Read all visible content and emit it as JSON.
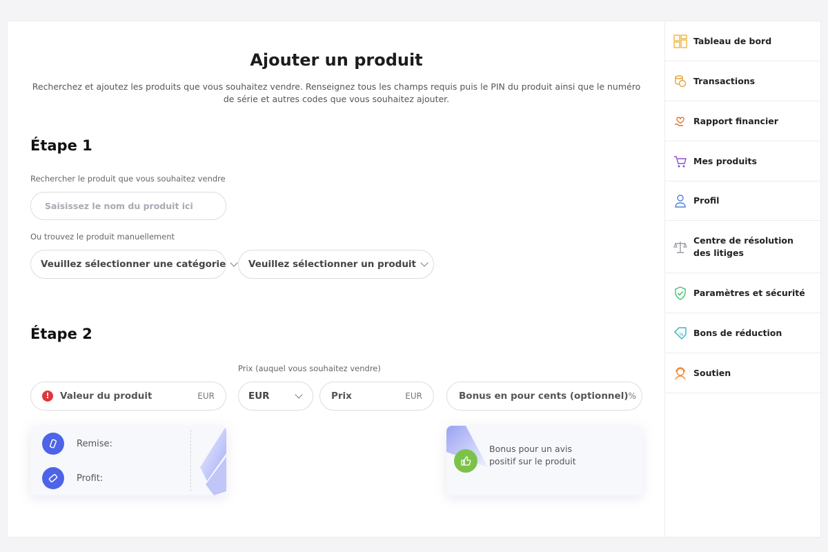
{
  "page": {
    "title": "Ajouter un produit",
    "description": "Recherchez et ajoutez les produits que vous souhaitez vendre. Renseignez tous les champs requis puis le PIN du produit ainsi que le numéro de série et autres codes que vous souhaitez ajouter."
  },
  "step1": {
    "title": "Étape 1",
    "search_label": "Rechercher le produit que vous souhaitez vendre",
    "search_placeholder": "Saisissez le nom du produit ici",
    "manual_label": "Ou trouvez le produit manuellement",
    "category_select": "Veuillez sélectionner une catégorie",
    "product_select": "Veuillez sélectionner un produit"
  },
  "step2": {
    "title": "Étape 2",
    "price_label": "Prix (auquel vous souhaitez vendre)",
    "product_value_label": "Valeur du produit",
    "product_value_unit": "EUR",
    "currency_select": "EUR",
    "price_placeholder": "Prix",
    "price_unit": "EUR",
    "bonus_label": "Bonus en pour cents (optionnel)",
    "bonus_unit": "%",
    "discount_label": "Remise:",
    "profit_label": "Profit:",
    "review_bonus_text": "Bonus pour un avis positif sur le produit"
  },
  "sidebar": {
    "items": [
      {
        "label": "Tableau de bord",
        "icon": "dashboard-icon",
        "color": "#f0b84a"
      },
      {
        "label": "Transactions",
        "icon": "coins-icon",
        "color": "#e8a33a"
      },
      {
        "label": "Rapport financier",
        "icon": "hand-heart-icon",
        "color": "#d9762f"
      },
      {
        "label": "Mes produits",
        "icon": "cart-icon",
        "color": "#8a4fc9"
      },
      {
        "label": "Profil",
        "icon": "user-icon",
        "color": "#4e7fd8"
      },
      {
        "label": "Centre de résolution des litiges",
        "icon": "scales-icon",
        "color": "#9a9aa3"
      },
      {
        "label": "Paramètres et sécurité",
        "icon": "shield-icon",
        "color": "#3ec46d"
      },
      {
        "label": "Bons de réduction",
        "icon": "coupon-icon",
        "color": "#2bb5c2"
      },
      {
        "label": "Soutien",
        "icon": "support-icon",
        "color": "#f08a2f"
      }
    ]
  },
  "colors": {
    "accent_blue": "#4d63e8",
    "error_red": "#e0373b",
    "success_green": "#7cc24a"
  }
}
